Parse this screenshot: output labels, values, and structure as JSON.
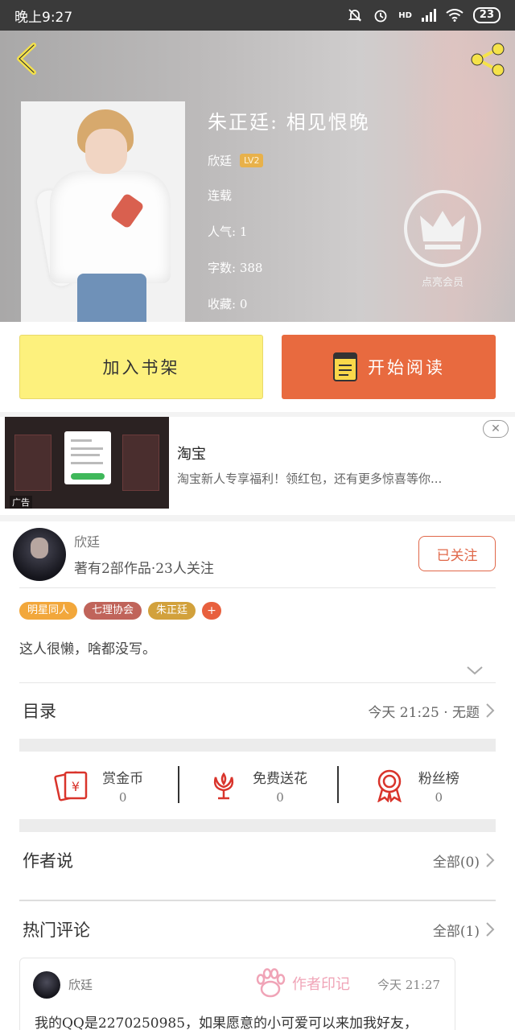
{
  "status_bar": {
    "time": "晚上9:27",
    "network": "HD",
    "battery": "23"
  },
  "book": {
    "title": "朱正廷: 相见恨晚",
    "author": "欣廷",
    "author_level": "LV2",
    "status": "连载",
    "popularity": "人气: 1",
    "word_count": "字数: 388",
    "favorites": "收藏: 0",
    "vip_label": "点亮会员"
  },
  "actions": {
    "add_shelf": "加入书架",
    "start_read": "开始阅读"
  },
  "ad": {
    "tag": "广告",
    "title": "淘宝",
    "desc": "淘宝新人专享福利！领红包，还有更多惊喜等你..."
  },
  "author_card": {
    "name": "欣廷",
    "stats": "著有2部作品·23人关注",
    "follow_label": "已关注"
  },
  "tags": [
    {
      "label": "明星同人",
      "color": "#f2a73b"
    },
    {
      "label": "七理协会",
      "color": "#c0645a"
    },
    {
      "label": "朱正廷",
      "color": "#d2a13c"
    }
  ],
  "tag_add": "+",
  "bio": "这人很懒，啥都没写。",
  "catalog": {
    "label": "目录",
    "latest": "今天 21:25 · 无题"
  },
  "stats": [
    {
      "label": "赏金币",
      "value": "0",
      "icon": "coin-envelope-icon"
    },
    {
      "label": "免费送花",
      "value": "0",
      "icon": "flower-icon"
    },
    {
      "label": "粉丝榜",
      "value": "0",
      "icon": "medal-icon"
    }
  ],
  "author_says": {
    "label": "作者说",
    "all": "全部(0)"
  },
  "hot_comments": {
    "label": "热门评论",
    "all": "全部(1)"
  },
  "comment": {
    "name": "欣廷",
    "stamp": "作者印记",
    "time": "今天 21:27",
    "text": "我的QQ是2270250985，如果愿意的小可爱可以来加我好友，"
  },
  "colors": {
    "accent": "#e86a3f",
    "shelf_button": "#fdf17d",
    "stamp": "#f0a4b7"
  }
}
